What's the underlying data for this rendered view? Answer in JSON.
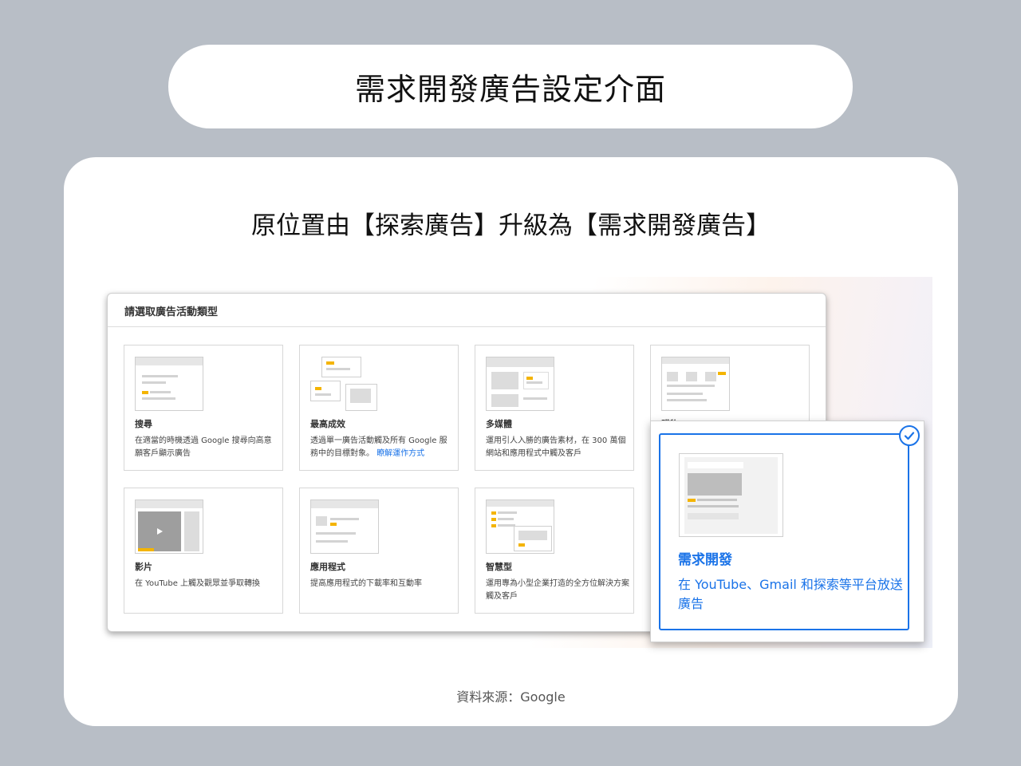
{
  "header": {
    "title": "需求開發廣告設定介面"
  },
  "card": {
    "subtitle": "原位置由【探索廣告】升級為【需求開發廣告】",
    "source": "資料來源：Google"
  },
  "dialog": {
    "title": "請選取廣告活動類型",
    "options": [
      {
        "title": "搜尋",
        "desc": "在適當的時機透過 Google 搜尋向高意願客戶顯示廣告"
      },
      {
        "title": "最高成效",
        "desc": "透過單一廣告活動觸及所有 Google 服務中的目標對象。",
        "link": "瞭解運作方式"
      },
      {
        "title": "多媒體",
        "desc": "運用引人入勝的廣告素材，在 300 萬個網站和應用程式中觸及客戶"
      },
      {
        "title": "購物",
        "desc": ""
      },
      {
        "title": "影片",
        "desc": "在 YouTube 上觸及觀眾並爭取轉換"
      },
      {
        "title": "應用程式",
        "desc": "提高應用程式的下載率和互動率"
      },
      {
        "title": "智慧型",
        "desc": "運用專為小型企業打造的全方位解決方案觸及客戶"
      }
    ]
  },
  "selected": {
    "title": "需求開發",
    "desc": "在 YouTube、Gmail 和探索等平台放送廣告",
    "icon": "check-circle-icon"
  },
  "colors": {
    "accent": "#1a73e8",
    "yellow": "#f4b400",
    "background": "#b8bec6"
  }
}
